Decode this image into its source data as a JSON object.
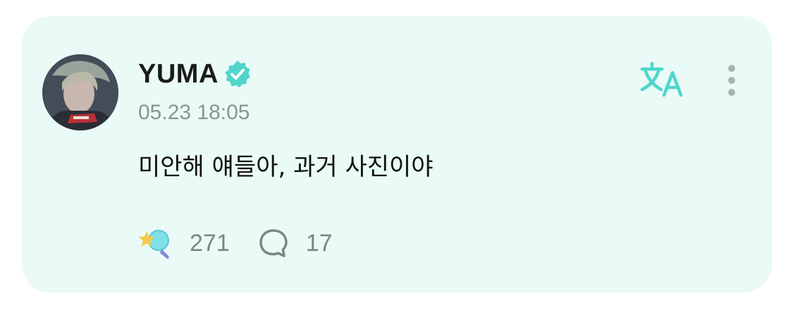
{
  "post": {
    "author": "YUMA",
    "verified": true,
    "timestamp": "05.23 18:05",
    "text": "미안해 얘들아, 과거 사진이야",
    "reactions_count": "271",
    "comments_count": "17"
  },
  "icons": {
    "avatar": "avatar-photo",
    "verified": "verified-badge-icon",
    "translate": "translate-icon",
    "more": "more-vertical-icon",
    "reaction": "star-lightstick-reaction-icon",
    "comment": "comment-bubble-icon"
  },
  "colors": {
    "card_background": "#e9faf7",
    "accent": "#4fd6cb",
    "text_primary": "#1b1b1b",
    "text_secondary": "#8a9590"
  }
}
